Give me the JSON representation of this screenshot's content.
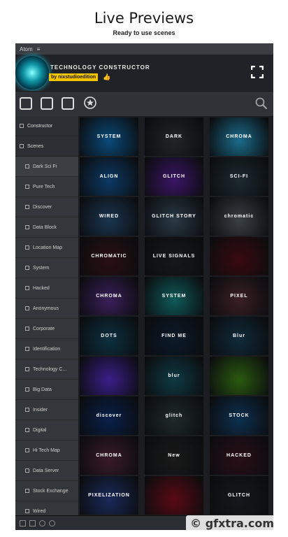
{
  "hero": {
    "title": "Live Previews",
    "subtitle": "Ready to use scenes"
  },
  "window": {
    "app_name": "Atom",
    "menu_glyph": "≡",
    "brand": "TECHNOLOGY CONSTRUCTOR",
    "author": "by nixstudioedition",
    "thumbs_glyph": "👍"
  },
  "toolbar": {
    "icons": [
      "sliders-icon",
      "layers-icon",
      "clipboard-icon",
      "star-icon"
    ],
    "search_icon": "search-icon"
  },
  "sidebar": {
    "top_items": [
      {
        "label": "Constructor"
      },
      {
        "label": "Scenes"
      }
    ],
    "scenes": [
      {
        "label": "Dark Sci Fi"
      },
      {
        "label": "Pure Tech"
      },
      {
        "label": "Discover"
      },
      {
        "label": "Data Block"
      },
      {
        "label": "Location Map"
      },
      {
        "label": "System"
      },
      {
        "label": "Hacked"
      },
      {
        "label": "Anonymous"
      },
      {
        "label": "Corporate"
      },
      {
        "label": "Identification"
      },
      {
        "label": "Technology C..."
      },
      {
        "label": "Big Data"
      },
      {
        "label": "Insider"
      },
      {
        "label": "Digital"
      },
      {
        "label": "Hi Tech Map"
      },
      {
        "label": "Data Server"
      },
      {
        "label": "Stock Exchange"
      },
      {
        "label": "Wired"
      }
    ]
  },
  "grid": {
    "thumbnails": [
      {
        "label": "SYSTEM",
        "color": "#0a4a7a"
      },
      {
        "label": "DARK",
        "color": "#222428"
      },
      {
        "label": "CHROMA",
        "color": "#1a6b8a"
      },
      {
        "label": "ALIGN",
        "color": "#0c3a66"
      },
      {
        "label": "GLITCH",
        "color": "#3a1566"
      },
      {
        "label": "SCI-FI",
        "color": "#1c2a30"
      },
      {
        "label": "WIRED",
        "color": "#1a3550"
      },
      {
        "label": "GLITCH STORY",
        "color": "#2a3a46"
      },
      {
        "label": "chromatic",
        "color": "#3a3f44"
      },
      {
        "label": "CHROMATIC",
        "color": "#2a0f14"
      },
      {
        "label": "LIVE SIGNALS",
        "color": "#15181c"
      },
      {
        "label": "",
        "color": "#3a0a10"
      },
      {
        "label": "CHROMA",
        "color": "#3a1f5a"
      },
      {
        "label": "SYSTEM",
        "color": "#0f5a5a"
      },
      {
        "label": "PIXEL",
        "color": "#3a1f24"
      },
      {
        "label": "DOTS",
        "color": "#0c3040"
      },
      {
        "label": "FIND ME",
        "color": "#0a1a2a"
      },
      {
        "label": "Blur",
        "color": "#102a3a"
      },
      {
        "label": "",
        "color": "#3a1f8a"
      },
      {
        "label": "blur",
        "color": "#0f3a44"
      },
      {
        "label": "",
        "color": "#2a5a10"
      },
      {
        "label": "discover",
        "color": "#08204a"
      },
      {
        "label": "glitch",
        "color": "#1f2a2a"
      },
      {
        "label": "STOCK",
        "color": "#0c3050"
      },
      {
        "label": "CHROMA",
        "color": "#3a1a2a"
      },
      {
        "label": "New",
        "color": "#1a1a1a"
      },
      {
        "label": "HACKED",
        "color": "#2a0f18"
      },
      {
        "label": "PIXELIZATION",
        "color": "#1a2a5a"
      },
      {
        "label": "",
        "color": "#5a0a14"
      },
      {
        "label": "GLITCH",
        "color": "#15181c"
      }
    ]
  },
  "statusbar": {
    "icons": [
      "panel-icon",
      "grid-icon",
      "play-icon",
      "gear-icon"
    ]
  },
  "watermark": "© gfxtra.com"
}
